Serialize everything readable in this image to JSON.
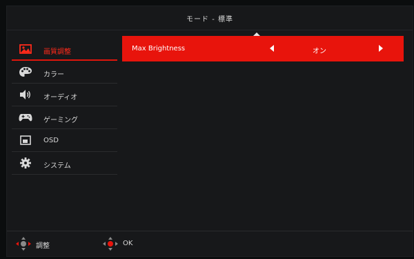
{
  "header": {
    "title": "モード - 標準"
  },
  "sidebar": {
    "items": [
      {
        "label": "画質調整",
        "icon": "picture-icon",
        "active": true
      },
      {
        "label": "カラー",
        "icon": "palette-icon"
      },
      {
        "label": "オーディオ",
        "icon": "speaker-icon"
      },
      {
        "label": "ゲーミング",
        "icon": "gamepad-icon"
      },
      {
        "label": "OSD",
        "icon": "osd-icon"
      },
      {
        "label": "システム",
        "icon": "gear-icon"
      }
    ]
  },
  "main": {
    "settings": [
      {
        "label": "Max Brightness",
        "value": "オン"
      }
    ]
  },
  "footer": {
    "adjust_label": "調整",
    "ok_label": "OK"
  },
  "colors": {
    "accent": "#e8140c",
    "panel": "#17181a",
    "text": "#d8d8d8"
  }
}
